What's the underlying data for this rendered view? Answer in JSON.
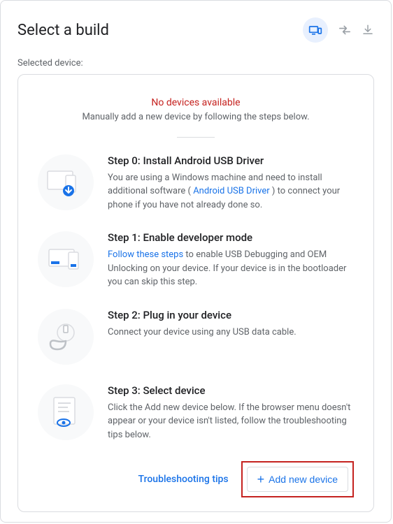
{
  "header": {
    "title": "Select a build"
  },
  "selected_label": "Selected device:",
  "no_devices": {
    "title": "No devices available",
    "subtitle": "Manually add a new device by following the steps below."
  },
  "steps": {
    "s0": {
      "title": "Step 0: Install Android USB Driver",
      "desc_pre": "You are using a Windows machine and need to install additional software ( ",
      "link": "Android USB Driver",
      "desc_post": " ) to connect your phone if you have not already done so."
    },
    "s1": {
      "title": "Step 1: Enable developer mode",
      "link": "Follow these steps",
      "desc_post": " to enable USB Debugging and OEM Unlocking on your device. If your device is in the bootloader you can skip this step."
    },
    "s2": {
      "title": "Step 2: Plug in your device",
      "desc": "Connect your device using any USB data cable."
    },
    "s3": {
      "title": "Step 3: Select device",
      "desc": "Click the Add new device below. If the browser menu doesn't appear or your device isn't listed, follow the troubleshooting tips below."
    }
  },
  "footer": {
    "tips": "Troubleshooting tips",
    "add_device": "Add new device"
  }
}
